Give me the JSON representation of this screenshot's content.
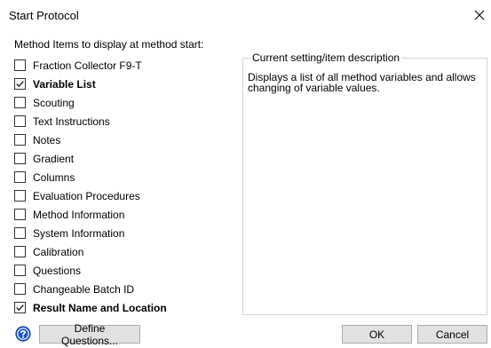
{
  "window": {
    "title": "Start Protocol",
    "close_glyph": "✕"
  },
  "left_panel": {
    "label": "Method Items to display at method start:",
    "items": [
      {
        "label": "Fraction Collector F9-T",
        "checked": false,
        "bold": false
      },
      {
        "label": "Variable List",
        "checked": true,
        "bold": true
      },
      {
        "label": "Scouting",
        "checked": false,
        "bold": false
      },
      {
        "label": "Text Instructions",
        "checked": false,
        "bold": false
      },
      {
        "label": "Notes",
        "checked": false,
        "bold": false
      },
      {
        "label": "Gradient",
        "checked": false,
        "bold": false
      },
      {
        "label": "Columns",
        "checked": false,
        "bold": false
      },
      {
        "label": "Evaluation Procedures",
        "checked": false,
        "bold": false
      },
      {
        "label": "Method Information",
        "checked": false,
        "bold": false
      },
      {
        "label": "System Information",
        "checked": false,
        "bold": false
      },
      {
        "label": "Calibration",
        "checked": false,
        "bold": false
      },
      {
        "label": "Questions",
        "checked": false,
        "bold": false
      },
      {
        "label": "Changeable Batch ID",
        "checked": false,
        "bold": false
      },
      {
        "label": "Result Name and Location",
        "checked": true,
        "bold": true
      }
    ]
  },
  "right_panel": {
    "group_title": "Current setting/item description",
    "description": "Displays a list of all method variables and allows changing of variable values."
  },
  "footer": {
    "help_icon": "help-icon",
    "define_questions_label": "Define Questions...",
    "ok_label": "OK",
    "cancel_label": "Cancel"
  },
  "colors": {
    "help_icon_blue": "#1f57c3",
    "button_face": "#e1e1e1",
    "button_border": "#adadad",
    "group_border": "#d5d5d5"
  }
}
